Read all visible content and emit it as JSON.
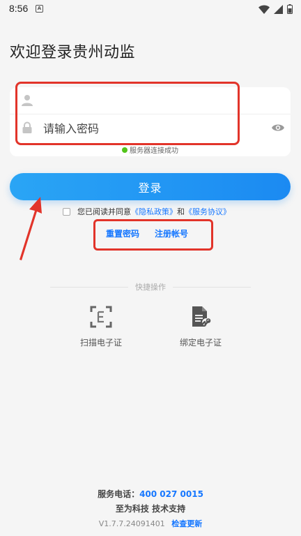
{
  "status_bar": {
    "time": "8:56",
    "notification_icon": "a-icon",
    "wifi_icon": "wifi-icon",
    "signal_icon": "signal-icon",
    "battery_icon": "battery-icon"
  },
  "page": {
    "welcome_title": "欢迎登录贵州动监"
  },
  "form": {
    "username_value": "",
    "username_placeholder": "",
    "password_placeholder": "请输入密码",
    "server_status": "服务器连接成功",
    "server_status_color": "#52c41a"
  },
  "login_button": {
    "label": "登录",
    "color": "#1b8af2"
  },
  "agreement": {
    "prefix": "您已阅读并同意",
    "privacy_link": "《隐私政策》",
    "and": "和",
    "service_link": "《服务协议》",
    "checked": false
  },
  "links": {
    "reset_password": "重置密码",
    "register": "注册帐号"
  },
  "quick_actions": {
    "title": "快捷操作",
    "items": [
      {
        "label": "扫描电子证",
        "icon": "scan-icon"
      },
      {
        "label": "绑定电子证",
        "icon": "bind-certificate-icon"
      }
    ]
  },
  "footer": {
    "phone_label": "服务电话：",
    "phone_number": "400 027 0015",
    "support": "至为科技 技术支持",
    "version": "V1.7.7.24091401",
    "check_update": "检查更新"
  },
  "annotation_color": "#e2342a"
}
